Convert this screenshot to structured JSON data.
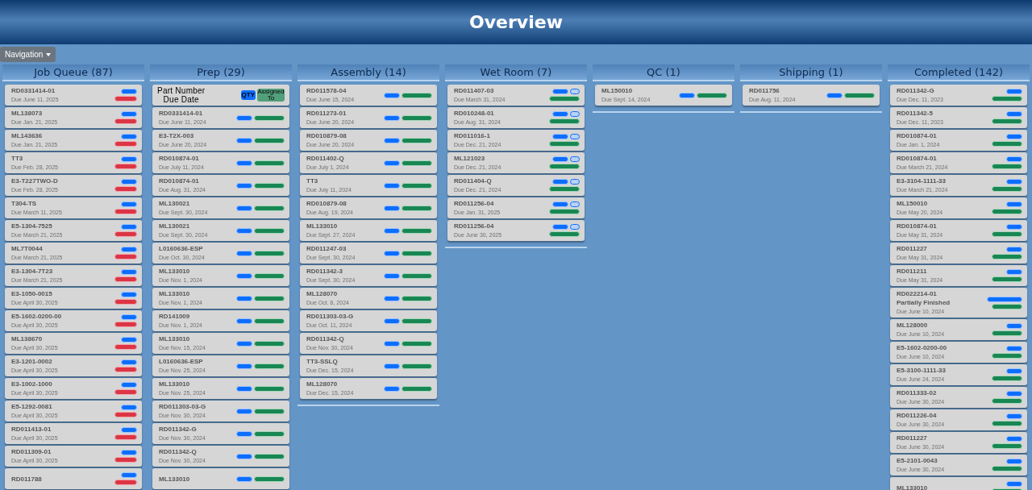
{
  "header": {
    "title": "Overview"
  },
  "navigation": {
    "label": "Navigation"
  },
  "columns": [
    {
      "title": "Job Queue (87)",
      "cards": [
        {
          "kind": "job",
          "part": "RD0331414-01",
          "due": "Due June 11, 2025",
          "badges": [
            [
              {
                "kind": "qty"
              }
            ],
            [
              {
                "kind": "priority"
              }
            ]
          ]
        },
        {
          "kind": "job",
          "part": "ML138073",
          "due": "Due Jan. 21, 2025",
          "badges": [
            [
              {
                "kind": "qty"
              }
            ],
            [
              {
                "kind": "priority"
              }
            ]
          ]
        },
        {
          "kind": "job",
          "part": "ML143636",
          "due": "Due Jan. 21, 2025",
          "badges": [
            [
              {
                "kind": "qty"
              }
            ],
            [
              {
                "kind": "priority"
              }
            ]
          ]
        },
        {
          "kind": "job",
          "part": "TT3",
          "due": "Due Feb. 28, 2025",
          "badges": [
            [
              {
                "kind": "qty"
              }
            ],
            [
              {
                "kind": "priority"
              }
            ]
          ]
        },
        {
          "kind": "job",
          "part": "E3-T227TWO-D",
          "due": "Due Feb. 28, 2025",
          "badges": [
            [
              {
                "kind": "qty"
              }
            ],
            [
              {
                "kind": "priority"
              }
            ]
          ]
        },
        {
          "kind": "job",
          "part": "T304-TS",
          "due": "Due March 11, 2025",
          "badges": [
            [
              {
                "kind": "qty"
              }
            ],
            [
              {
                "kind": "priority"
              }
            ]
          ]
        },
        {
          "kind": "job",
          "part": "E5-1304-7525",
          "due": "Due March 21, 2025",
          "badges": [
            [
              {
                "kind": "qty"
              }
            ],
            [
              {
                "kind": "priority"
              }
            ]
          ]
        },
        {
          "kind": "job",
          "part": "ML7T0044",
          "due": "Due March 21, 2025",
          "badges": [
            [
              {
                "kind": "qty"
              }
            ],
            [
              {
                "kind": "priority"
              }
            ]
          ]
        },
        {
          "kind": "job",
          "part": "E3-1304-7T23",
          "due": "Due March 21, 2025",
          "badges": [
            [
              {
                "kind": "qty"
              }
            ],
            [
              {
                "kind": "priority"
              }
            ]
          ]
        },
        {
          "kind": "job",
          "part": "E3-1050-0015",
          "due": "Due April 30, 2025",
          "badges": [
            [
              {
                "kind": "qty"
              }
            ],
            [
              {
                "kind": "priority"
              }
            ]
          ]
        },
        {
          "kind": "job",
          "part": "E5-1602-0200-00",
          "due": "Due April 30, 2025",
          "badges": [
            [
              {
                "kind": "qty"
              }
            ],
            [
              {
                "kind": "priority"
              }
            ]
          ]
        },
        {
          "kind": "job",
          "part": "ML138670",
          "due": "Due April 30, 2025",
          "badges": [
            [
              {
                "kind": "qty"
              }
            ],
            [
              {
                "kind": "priority"
              }
            ]
          ]
        },
        {
          "kind": "job",
          "part": "E3-1201-0002",
          "due": "Due April 30, 2025",
          "badges": [
            [
              {
                "kind": "qty"
              }
            ],
            [
              {
                "kind": "priority"
              }
            ]
          ]
        },
        {
          "kind": "job",
          "part": "E3-1002-1000",
          "due": "Due April 30, 2025",
          "badges": [
            [
              {
                "kind": "qty"
              }
            ],
            [
              {
                "kind": "priority"
              }
            ]
          ]
        },
        {
          "kind": "job",
          "part": "E5-1292-0081",
          "due": "Due April 30, 2025",
          "badges": [
            [
              {
                "kind": "qty"
              }
            ],
            [
              {
                "kind": "priority"
              }
            ]
          ]
        },
        {
          "kind": "job",
          "part": "RD011413-01",
          "due": "Due April 30, 2025",
          "badges": [
            [
              {
                "kind": "qty"
              }
            ],
            [
              {
                "kind": "priority"
              }
            ]
          ]
        },
        {
          "kind": "job",
          "part": "RD011309-01",
          "due": "Due April 30, 2025",
          "badges": [
            [
              {
                "kind": "qty"
              }
            ],
            [
              {
                "kind": "priority"
              }
            ]
          ]
        },
        {
          "kind": "job",
          "part": "RD011788",
          "badges": [
            [
              {
                "kind": "qty"
              }
            ],
            [
              {
                "kind": "priority"
              }
            ]
          ]
        }
      ]
    },
    {
      "title": "Prep (29)",
      "cards": [
        {
          "kind": "header",
          "part": "Part Number",
          "due": "Due Date",
          "qty": "QTY",
          "assigned": "Assigned To"
        },
        {
          "kind": "job",
          "part": "RD0331414-01",
          "due": "Due June 11, 2024",
          "badges": [
            [
              {
                "kind": "qty"
              },
              {
                "kind": "assignee"
              }
            ]
          ]
        },
        {
          "kind": "job",
          "part": "E3-T2X-003",
          "due": "Due June 20, 2024",
          "badges": [
            [
              {
                "kind": "qty"
              },
              {
                "kind": "assignee"
              }
            ]
          ]
        },
        {
          "kind": "job",
          "part": "RD010874-01",
          "due": "Due July 11, 2024",
          "badges": [
            [
              {
                "kind": "qty"
              },
              {
                "kind": "assignee"
              }
            ]
          ]
        },
        {
          "kind": "job",
          "part": "RD010874-01",
          "due": "Due Aug. 31, 2024",
          "badges": [
            [
              {
                "kind": "qty"
              },
              {
                "kind": "assignee"
              }
            ]
          ]
        },
        {
          "kind": "job",
          "part": "ML130021",
          "due": "Due Sept. 30, 2024",
          "badges": [
            [
              {
                "kind": "qty"
              },
              {
                "kind": "assignee"
              }
            ]
          ]
        },
        {
          "kind": "job",
          "part": "ML130021",
          "due": "Due Sept. 30, 2024",
          "badges": [
            [
              {
                "kind": "qty"
              },
              {
                "kind": "assignee"
              }
            ]
          ]
        },
        {
          "kind": "job",
          "part": "L0160636-ESP",
          "due": "Due Oct. 30, 2024",
          "badges": [
            [
              {
                "kind": "qty"
              },
              {
                "kind": "assignee"
              }
            ]
          ]
        },
        {
          "kind": "job",
          "part": "ML133010",
          "due": "Due Nov. 1, 2024",
          "badges": [
            [
              {
                "kind": "qty"
              },
              {
                "kind": "assignee"
              }
            ]
          ]
        },
        {
          "kind": "job",
          "part": "ML133010",
          "due": "Due Nov. 1, 2024",
          "badges": [
            [
              {
                "kind": "qty"
              },
              {
                "kind": "assignee"
              }
            ]
          ]
        },
        {
          "kind": "job",
          "part": "RD141009",
          "due": "Due Nov. 1, 2024",
          "badges": [
            [
              {
                "kind": "qty"
              },
              {
                "kind": "assignee"
              }
            ]
          ]
        },
        {
          "kind": "job",
          "part": "ML133010",
          "due": "Due Nov. 15, 2024",
          "badges": [
            [
              {
                "kind": "qty"
              },
              {
                "kind": "assignee"
              }
            ]
          ]
        },
        {
          "kind": "job",
          "part": "L0160636-ESP",
          "due": "Due Nov. 25, 2024",
          "badges": [
            [
              {
                "kind": "qty"
              },
              {
                "kind": "assignee"
              }
            ]
          ]
        },
        {
          "kind": "job",
          "part": "ML133010",
          "due": "Due Nov. 25, 2024",
          "badges": [
            [
              {
                "kind": "qty"
              },
              {
                "kind": "assignee"
              }
            ]
          ]
        },
        {
          "kind": "job",
          "part": "RD011303-03-G",
          "due": "Due Nov. 30, 2024",
          "badges": [
            [
              {
                "kind": "qty"
              },
              {
                "kind": "assignee"
              }
            ]
          ]
        },
        {
          "kind": "job",
          "part": "RD011342-G",
          "due": "Due Nov. 30, 2024",
          "badges": [
            [
              {
                "kind": "qty"
              },
              {
                "kind": "assignee"
              }
            ]
          ]
        },
        {
          "kind": "job",
          "part": "RD011342-Q",
          "due": "Due Nov. 30, 2024",
          "badges": [
            [
              {
                "kind": "qty"
              },
              {
                "kind": "assignee"
              }
            ]
          ]
        },
        {
          "kind": "job",
          "part": "ML133010",
          "badges": [
            [
              {
                "kind": "qty"
              },
              {
                "kind": "assignee"
              }
            ]
          ]
        }
      ]
    },
    {
      "title": "Assembly (14)",
      "cards": [
        {
          "kind": "job",
          "part": "RD011578-04",
          "due": "Due June 15, 2024",
          "badges": [
            [
              {
                "kind": "qty"
              },
              {
                "kind": "assignee"
              }
            ]
          ]
        },
        {
          "kind": "job",
          "part": "RD011273-01",
          "due": "Due June 20, 2024",
          "badges": [
            [
              {
                "kind": "qty"
              },
              {
                "kind": "assignee"
              }
            ]
          ]
        },
        {
          "kind": "job",
          "part": "RD010879-08",
          "due": "Due June 20, 2024",
          "badges": [
            [
              {
                "kind": "qty"
              },
              {
                "kind": "assignee"
              }
            ]
          ]
        },
        {
          "kind": "job",
          "part": "RD011402-Q",
          "due": "Due July 1, 2024",
          "badges": [
            [
              {
                "kind": "qty"
              },
              {
                "kind": "assignee"
              }
            ]
          ]
        },
        {
          "kind": "job",
          "part": "TT3",
          "due": "Due July 11, 2024",
          "badges": [
            [
              {
                "kind": "qty"
              },
              {
                "kind": "assignee"
              }
            ]
          ]
        },
        {
          "kind": "job",
          "part": "RD010879-08",
          "due": "Due Aug. 19, 2024",
          "badges": [
            [
              {
                "kind": "qty"
              },
              {
                "kind": "assignee"
              }
            ]
          ]
        },
        {
          "kind": "job",
          "part": "ML133010",
          "due": "Due Sept. 27, 2024",
          "badges": [
            [
              {
                "kind": "qty"
              },
              {
                "kind": "assignee"
              }
            ]
          ]
        },
        {
          "kind": "job",
          "part": "RD011247-03",
          "due": "Due Sept. 30, 2024",
          "badges": [
            [
              {
                "kind": "qty"
              },
              {
                "kind": "assignee"
              }
            ]
          ]
        },
        {
          "kind": "job",
          "part": "RD011342-3",
          "due": "Due Sept. 30, 2024",
          "badges": [
            [
              {
                "kind": "qty"
              },
              {
                "kind": "assignee"
              }
            ]
          ]
        },
        {
          "kind": "job",
          "part": "ML128070",
          "due": "Due Oct. 6, 2024",
          "badges": [
            [
              {
                "kind": "qty"
              },
              {
                "kind": "assignee"
              }
            ]
          ]
        },
        {
          "kind": "job",
          "part": "RD011303-03-G",
          "due": "Due Oct. 11, 2024",
          "badges": [
            [
              {
                "kind": "qty"
              },
              {
                "kind": "assignee"
              }
            ]
          ]
        },
        {
          "kind": "job",
          "part": "RD011342-Q",
          "due": "Due Nov. 30, 2024",
          "badges": [
            [
              {
                "kind": "qty"
              },
              {
                "kind": "assignee"
              }
            ]
          ]
        },
        {
          "kind": "job",
          "part": "TT3-SSLQ",
          "due": "Due Dec. 15, 2024",
          "badges": [
            [
              {
                "kind": "qty"
              },
              {
                "kind": "assignee"
              }
            ]
          ]
        },
        {
          "kind": "job",
          "part": "ML128070",
          "due": "Due Dec. 15, 2024",
          "badges": [
            [
              {
                "kind": "qty"
              },
              {
                "kind": "assignee"
              }
            ]
          ]
        }
      ]
    },
    {
      "title": "Wet Room (7)",
      "cards": [
        {
          "kind": "job",
          "part": "RD011407-03",
          "due": "Due March 31, 2024",
          "badges": [
            [
              {
                "kind": "qty"
              },
              {
                "kind": "extra"
              }
            ],
            [
              {
                "kind": "assignee"
              }
            ]
          ]
        },
        {
          "kind": "job",
          "part": "RD010248-01",
          "due": "Due Aug. 31, 2024",
          "badges": [
            [
              {
                "kind": "qty"
              },
              {
                "kind": "extra"
              }
            ],
            [
              {
                "kind": "assignee"
              }
            ]
          ]
        },
        {
          "kind": "job",
          "part": "RD011016-1",
          "due": "Due Dec. 21, 2024",
          "badges": [
            [
              {
                "kind": "qty"
              },
              {
                "kind": "extra"
              }
            ],
            [
              {
                "kind": "assignee"
              }
            ]
          ]
        },
        {
          "kind": "job",
          "part": "ML121023",
          "due": "Due Dec. 21, 2024",
          "badges": [
            [
              {
                "kind": "qty"
              },
              {
                "kind": "extra"
              }
            ],
            [
              {
                "kind": "assignee"
              }
            ]
          ]
        },
        {
          "kind": "job",
          "part": "RD011404-Q",
          "due": "Due Dec. 21, 2024",
          "badges": [
            [
              {
                "kind": "qty"
              },
              {
                "kind": "extra"
              }
            ],
            [
              {
                "kind": "assignee"
              }
            ]
          ]
        },
        {
          "kind": "job",
          "part": "RD011256-04",
          "due": "Due Jan. 31, 2025",
          "badges": [
            [
              {
                "kind": "qty"
              },
              {
                "kind": "extra"
              }
            ],
            [
              {
                "kind": "assignee"
              }
            ]
          ]
        },
        {
          "kind": "job",
          "part": "RD011256-04",
          "due": "Due June 30, 2025",
          "badges": [
            [
              {
                "kind": "qty"
              },
              {
                "kind": "extra"
              }
            ],
            [
              {
                "kind": "assignee"
              }
            ]
          ]
        }
      ]
    },
    {
      "title": "QC (1)",
      "cards": [
        {
          "kind": "job",
          "part": "ML150010",
          "due": "Due Sept. 14, 2024",
          "badges": [
            [
              {
                "kind": "qty"
              },
              {
                "kind": "assignee"
              }
            ]
          ]
        }
      ]
    },
    {
      "title": "Shipping (1)",
      "cards": [
        {
          "kind": "job",
          "part": "RD011756",
          "due": "Due Aug. 11, 2024",
          "badges": [
            [
              {
                "kind": "qty"
              },
              {
                "kind": "assignee"
              }
            ]
          ]
        }
      ]
    },
    {
      "title": "Completed (142)",
      "cards": [
        {
          "kind": "job",
          "part": "RD011342-G",
          "due": "Due Dec. 11, 2023",
          "badges": [
            [
              {
                "kind": "qty"
              }
            ],
            [
              {
                "kind": "assignee"
              }
            ]
          ]
        },
        {
          "kind": "job",
          "part": "RD011342-5",
          "due": "Due Dec. 11, 2023",
          "badges": [
            [
              {
                "kind": "qty"
              }
            ],
            [
              {
                "kind": "assignee"
              }
            ]
          ]
        },
        {
          "kind": "job",
          "part": "RD010874-01",
          "due": "Due Jan. 1, 2024",
          "badges": [
            [
              {
                "kind": "qty"
              }
            ],
            [
              {
                "kind": "assignee"
              }
            ]
          ]
        },
        {
          "kind": "job",
          "part": "RD010874-01",
          "due": "Due March 21, 2024",
          "badges": [
            [
              {
                "kind": "qty"
              }
            ],
            [
              {
                "kind": "assignee"
              }
            ]
          ]
        },
        {
          "kind": "job",
          "part": "E3-3104-1111-33",
          "due": "Due March 21, 2024",
          "badges": [
            [
              {
                "kind": "qty"
              }
            ],
            [
              {
                "kind": "assignee"
              }
            ]
          ]
        },
        {
          "kind": "job",
          "part": "ML150010",
          "due": "Due May 20, 2024",
          "badges": [
            [
              {
                "kind": "qty"
              }
            ],
            [
              {
                "kind": "assignee"
              }
            ]
          ]
        },
        {
          "kind": "job",
          "part": "RD010874-01",
          "due": "Due May 31, 2024",
          "badges": [
            [
              {
                "kind": "qty"
              }
            ],
            [
              {
                "kind": "assignee"
              }
            ]
          ]
        },
        {
          "kind": "job",
          "part": "RD011227",
          "due": "Due May 31, 2024",
          "badges": [
            [
              {
                "kind": "qty"
              }
            ],
            [
              {
                "kind": "assignee"
              }
            ]
          ]
        },
        {
          "kind": "job",
          "part": "RD011211",
          "due": "Due May 31, 2024",
          "badges": [
            [
              {
                "kind": "qty"
              }
            ],
            [
              {
                "kind": "assignee"
              }
            ]
          ]
        },
        {
          "kind": "job",
          "part": "RD022214-01",
          "note": "Partially Finished",
          "due": "Due June 10, 2024",
          "badges": [
            [
              {
                "kind": "status"
              }
            ],
            [
              {
                "kind": "assignee"
              }
            ]
          ]
        },
        {
          "kind": "job",
          "part": "ML128000",
          "due": "Due June 10, 2024",
          "badges": [
            [
              {
                "kind": "qty"
              }
            ],
            [
              {
                "kind": "assignee"
              }
            ]
          ]
        },
        {
          "kind": "job",
          "part": "E5-1602-0200-00",
          "due": "Due June 10, 2024",
          "badges": [
            [
              {
                "kind": "qty"
              }
            ],
            [
              {
                "kind": "assignee"
              }
            ]
          ]
        },
        {
          "kind": "job",
          "part": "E5-3100-1111-33",
          "due": "Due June 24, 2024",
          "badges": [
            [
              {
                "kind": "qty"
              }
            ],
            [
              {
                "kind": "assignee"
              }
            ]
          ]
        },
        {
          "kind": "job",
          "part": "RD011333-02",
          "due": "Due June 30, 2024",
          "badges": [
            [
              {
                "kind": "qty"
              }
            ],
            [
              {
                "kind": "assignee"
              }
            ]
          ]
        },
        {
          "kind": "job",
          "part": "RD011226-04",
          "due": "Due June 30, 2024",
          "badges": [
            [
              {
                "kind": "qty"
              }
            ],
            [
              {
                "kind": "assignee"
              }
            ]
          ]
        },
        {
          "kind": "job",
          "part": "RD011227",
          "due": "Due June 30, 2024",
          "badges": [
            [
              {
                "kind": "qty"
              }
            ],
            [
              {
                "kind": "assignee"
              }
            ]
          ]
        },
        {
          "kind": "job",
          "part": "E5-2101-0043",
          "due": "Due June 30, 2024",
          "badges": [
            [
              {
                "kind": "qty"
              }
            ],
            [
              {
                "kind": "assignee"
              }
            ]
          ]
        },
        {
          "kind": "job",
          "part": "ML133010",
          "badges": [
            [
              {
                "kind": "qty"
              }
            ],
            [
              {
                "kind": "assignee"
              }
            ]
          ]
        }
      ]
    }
  ]
}
